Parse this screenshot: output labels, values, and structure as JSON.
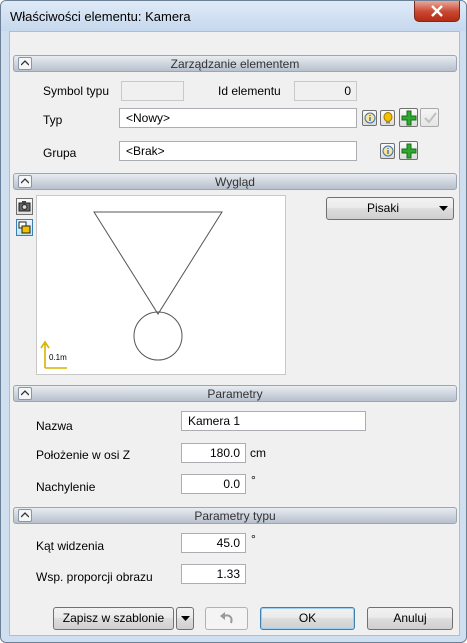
{
  "window": {
    "title": "Właściwości elementu: Kamera"
  },
  "sections": {
    "management": "Zarządzanie elementem",
    "appearance": "Wygląd",
    "parameters": "Parametry",
    "type_parameters": "Parametry typu"
  },
  "management": {
    "symbol_label": "Symbol typu",
    "symbol_value": "",
    "id_label": "Id elementu",
    "id_value": "0",
    "type_label": "Typ",
    "type_value": "<Nowy>",
    "group_label": "Grupa",
    "group_value": "<Brak>"
  },
  "appearance": {
    "pens_label": "Pisaki",
    "scale_label": "0.1m"
  },
  "parameters": {
    "name_label": "Nazwa",
    "name_value": "Kamera 1",
    "z_label": "Położenie w osi Z",
    "z_value": "180.0",
    "z_unit": "cm",
    "tilt_label": "Nachylenie",
    "tilt_value": "0.0",
    "tilt_unit": "°"
  },
  "type_parameters": {
    "angle_label": "Kąt widzenia",
    "angle_value": "45.0",
    "angle_unit": "°",
    "ratio_label": "Wsp. proporcji obrazu",
    "ratio_value": "1.33"
  },
  "footer": {
    "save_template": "Zapisz w szablonie",
    "ok": "OK",
    "cancel": "Anuluj"
  },
  "icons": [
    "close-icon",
    "chevron-up-icon",
    "info-icon",
    "bulb-icon",
    "plus-icon",
    "check-icon",
    "camera-icon",
    "shape-icon",
    "dropdown-arrow-icon",
    "undo-icon"
  ],
  "colors": {
    "plus_green": "#2ea82e",
    "close_red": "#c9462f",
    "scale_yellow": "#d8b400"
  }
}
